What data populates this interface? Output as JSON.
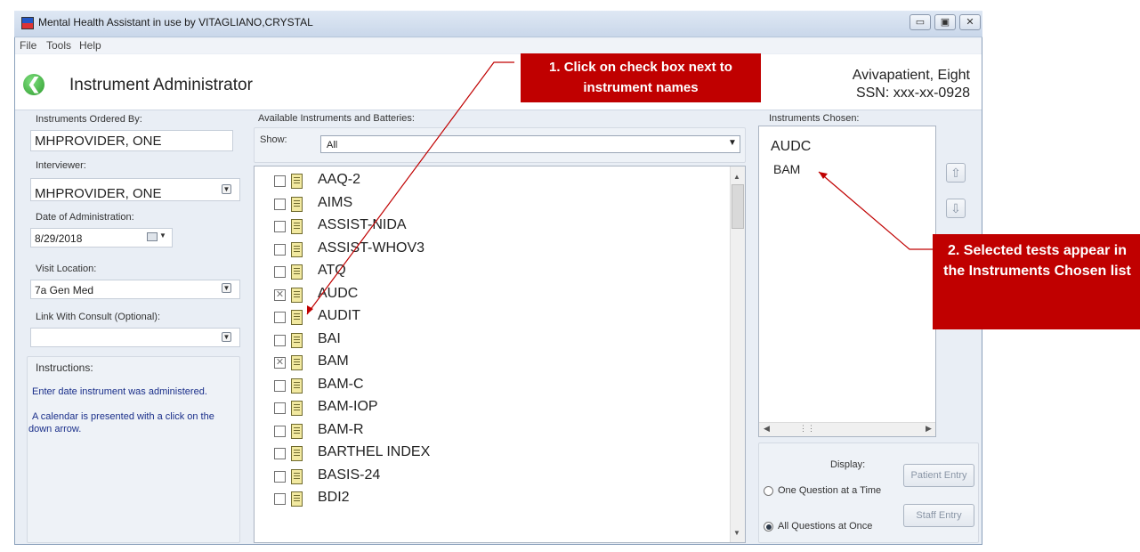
{
  "window": {
    "title": "Mental Health Assistant in use by VITAGLIANO,CRYSTAL",
    "buttons": [
      "▭",
      "▣",
      "✕"
    ]
  },
  "menu": [
    "File",
    "Tools",
    "Help"
  ],
  "header": {
    "title": "Instrument Administrator",
    "patient_name": "Avivapatient, Eight",
    "patient_ssn": "SSN: xxx-xx-0928"
  },
  "left": {
    "ordered_by_label": "Instruments Ordered By:",
    "ordered_by_value": "MHPROVIDER, ONE",
    "interviewer_label": "Interviewer:",
    "interviewer_value": "MHPROVIDER, ONE",
    "date_label": "Date of Administration:",
    "date_value": "8/29/2018",
    "location_label": "Visit Location:",
    "location_value": "7a Gen Med",
    "consult_label": "Link With Consult (Optional):",
    "consult_value": "",
    "instructions_label": "Instructions:",
    "instructions_1": "Enter date instrument was administered.",
    "instructions_2": "A calendar is presented with a click on the down arrow."
  },
  "middle": {
    "label": "Available Instruments and Batteries:",
    "show_label": "Show:",
    "show_value": "All",
    "instruments": [
      {
        "name": "AAQ-2",
        "checked": false
      },
      {
        "name": "AIMS",
        "checked": false
      },
      {
        "name": "ASSIST-NIDA",
        "checked": false
      },
      {
        "name": "ASSIST-WHOV3",
        "checked": false
      },
      {
        "name": "ATQ",
        "checked": false
      },
      {
        "name": "AUDC",
        "checked": true
      },
      {
        "name": "AUDIT",
        "checked": false
      },
      {
        "name": "BAI",
        "checked": false
      },
      {
        "name": "BAM",
        "checked": true
      },
      {
        "name": "BAM-C",
        "checked": false
      },
      {
        "name": "BAM-IOP",
        "checked": false
      },
      {
        "name": "BAM-R",
        "checked": false
      },
      {
        "name": "BARTHEL INDEX",
        "checked": false
      },
      {
        "name": "BASIS-24",
        "checked": false
      },
      {
        "name": "BDI2",
        "checked": false
      }
    ]
  },
  "right": {
    "label": "Instruments Chosen:",
    "chosen": [
      "AUDC",
      "BAM"
    ],
    "display_label": "Display:",
    "one_question": "One Question at a Time",
    "all_questions": "All Questions at Once",
    "selected_display": "all",
    "patient_entry": "Patient Entry",
    "staff_entry": "Staff Entry"
  },
  "callouts": {
    "step1": "1. Click on check box next to instrument names",
    "step2": "2. Selected tests appear in the Instruments Chosen list"
  }
}
